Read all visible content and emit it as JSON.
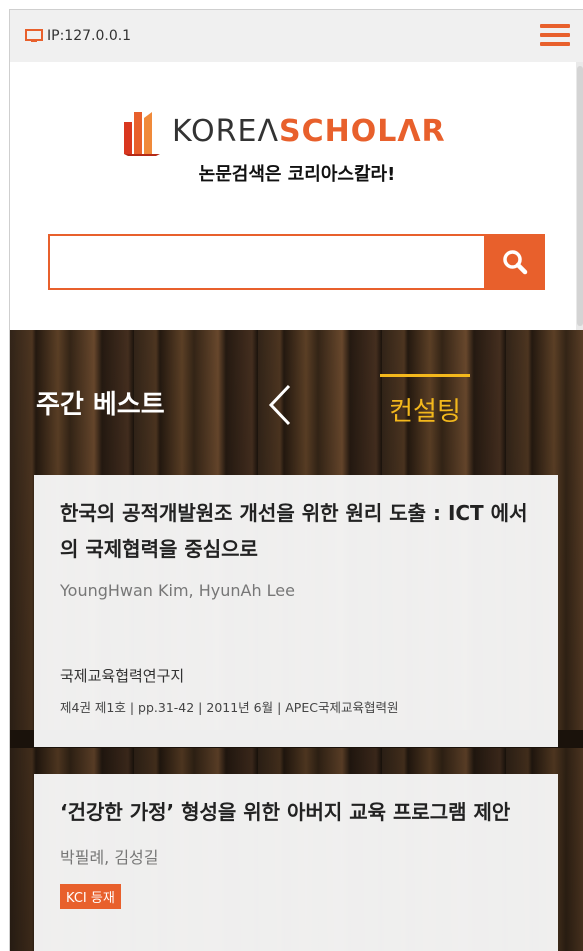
{
  "topbar": {
    "ip_label": "IP:127.0.0.1",
    "menu_icon": "hamburger-icon"
  },
  "logo": {
    "korea": "KOREΛ",
    "scholar": "SCHOLΛR"
  },
  "slogan": "논문검색은 코리아스칼라!",
  "search": {
    "value": "",
    "placeholder": "",
    "button_icon": "search-icon"
  },
  "hero": {
    "section_label": "주간 베스트",
    "active_tab": "컨설팅"
  },
  "cards": [
    {
      "title": "한국의 공적개발원조 개선을 위한 원리 도출 : ICT 에서의 국제협력을 중심으로",
      "authors": "YoungHwan Kim, HyunAh Lee",
      "journal": "국제교육협력연구지",
      "meta": "제4권 제1호 | pp.31-42 | 2011년 6월 | APEC국제교육협력원"
    },
    {
      "title": "‘건강한 가정’ 형성을 위한 아버지 교육 프로그램 제안",
      "authors": "박필례, 김성길",
      "badge": "KCI 등재"
    }
  ],
  "colors": {
    "accent": "#e8602c",
    "tab": "#f3b81c"
  }
}
